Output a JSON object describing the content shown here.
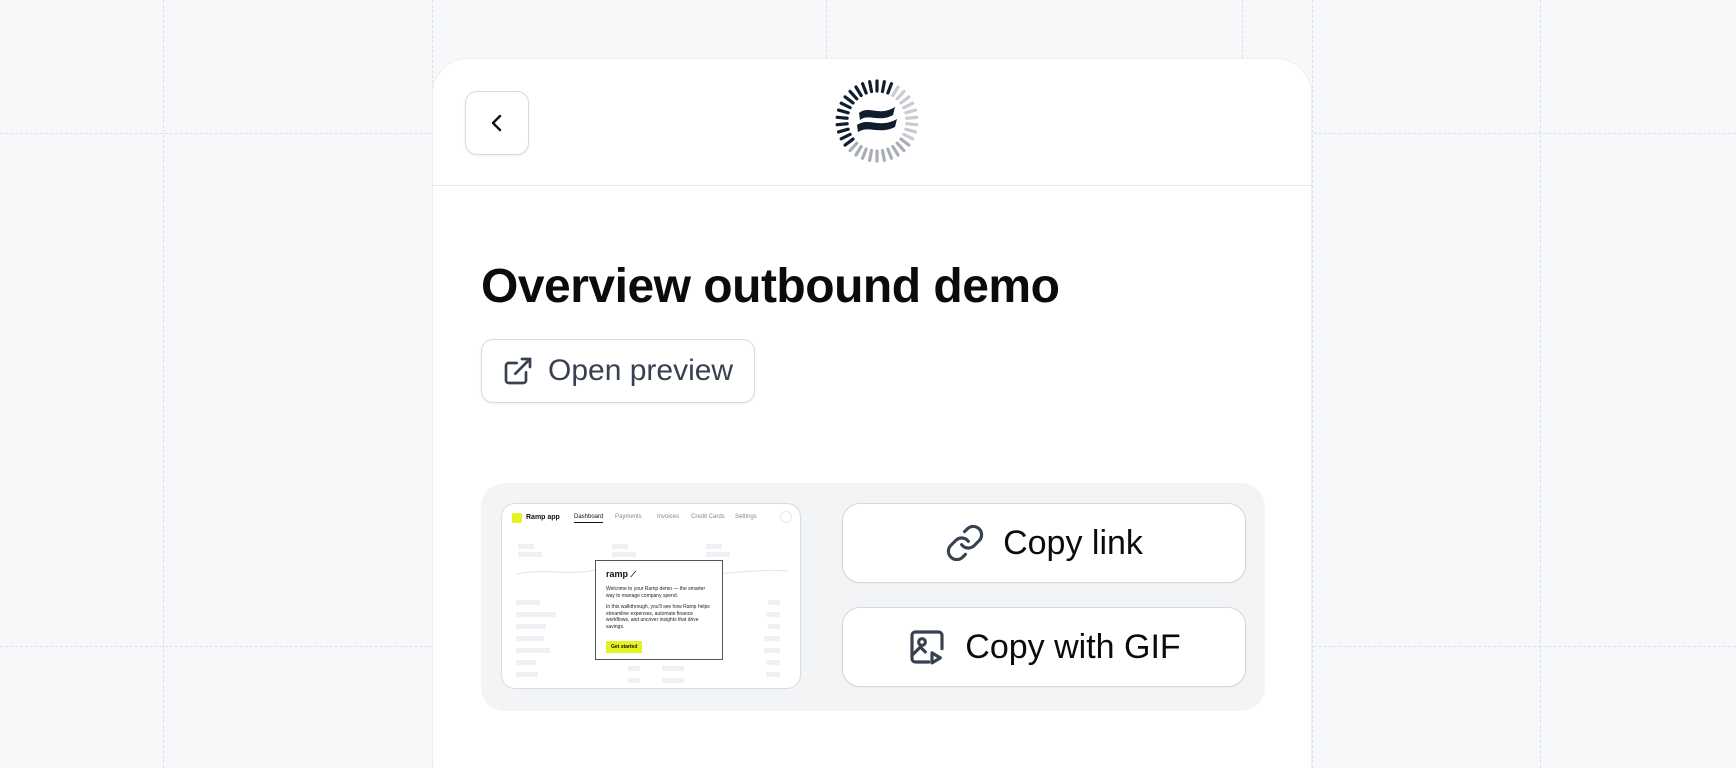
{
  "header": {
    "back_icon": "chevron-left-icon",
    "logo_icon": "wave-flag-logo"
  },
  "demo": {
    "title": "Overview outbound demo",
    "open_preview_label": "Open preview",
    "open_preview_icon": "external-link-icon"
  },
  "share": {
    "copy_link_label": "Copy link",
    "copy_link_icon": "link-icon",
    "copy_gif_label": "Copy with GIF",
    "copy_gif_icon": "image-play-icon"
  },
  "thumbnail": {
    "brand": "Ramp app",
    "tabs": [
      "Dashboard",
      "Payments",
      "Invoices",
      "Credit Cards",
      "Settings"
    ],
    "modal_brand": "ramp",
    "modal_text_1": "Welcome to your Ramp demo — the smarter way to manage company spend.",
    "modal_text_2": "In this walkthrough, you'll see how Ramp helps streamline expenses, automate finance workflows, and uncover insights that drive savings.",
    "modal_cta": "Get started"
  },
  "colors": {
    "accent": "#e4f222",
    "text": "#0b0b0c",
    "muted_text": "#374151",
    "panel_bg": "#f3f4f6"
  }
}
